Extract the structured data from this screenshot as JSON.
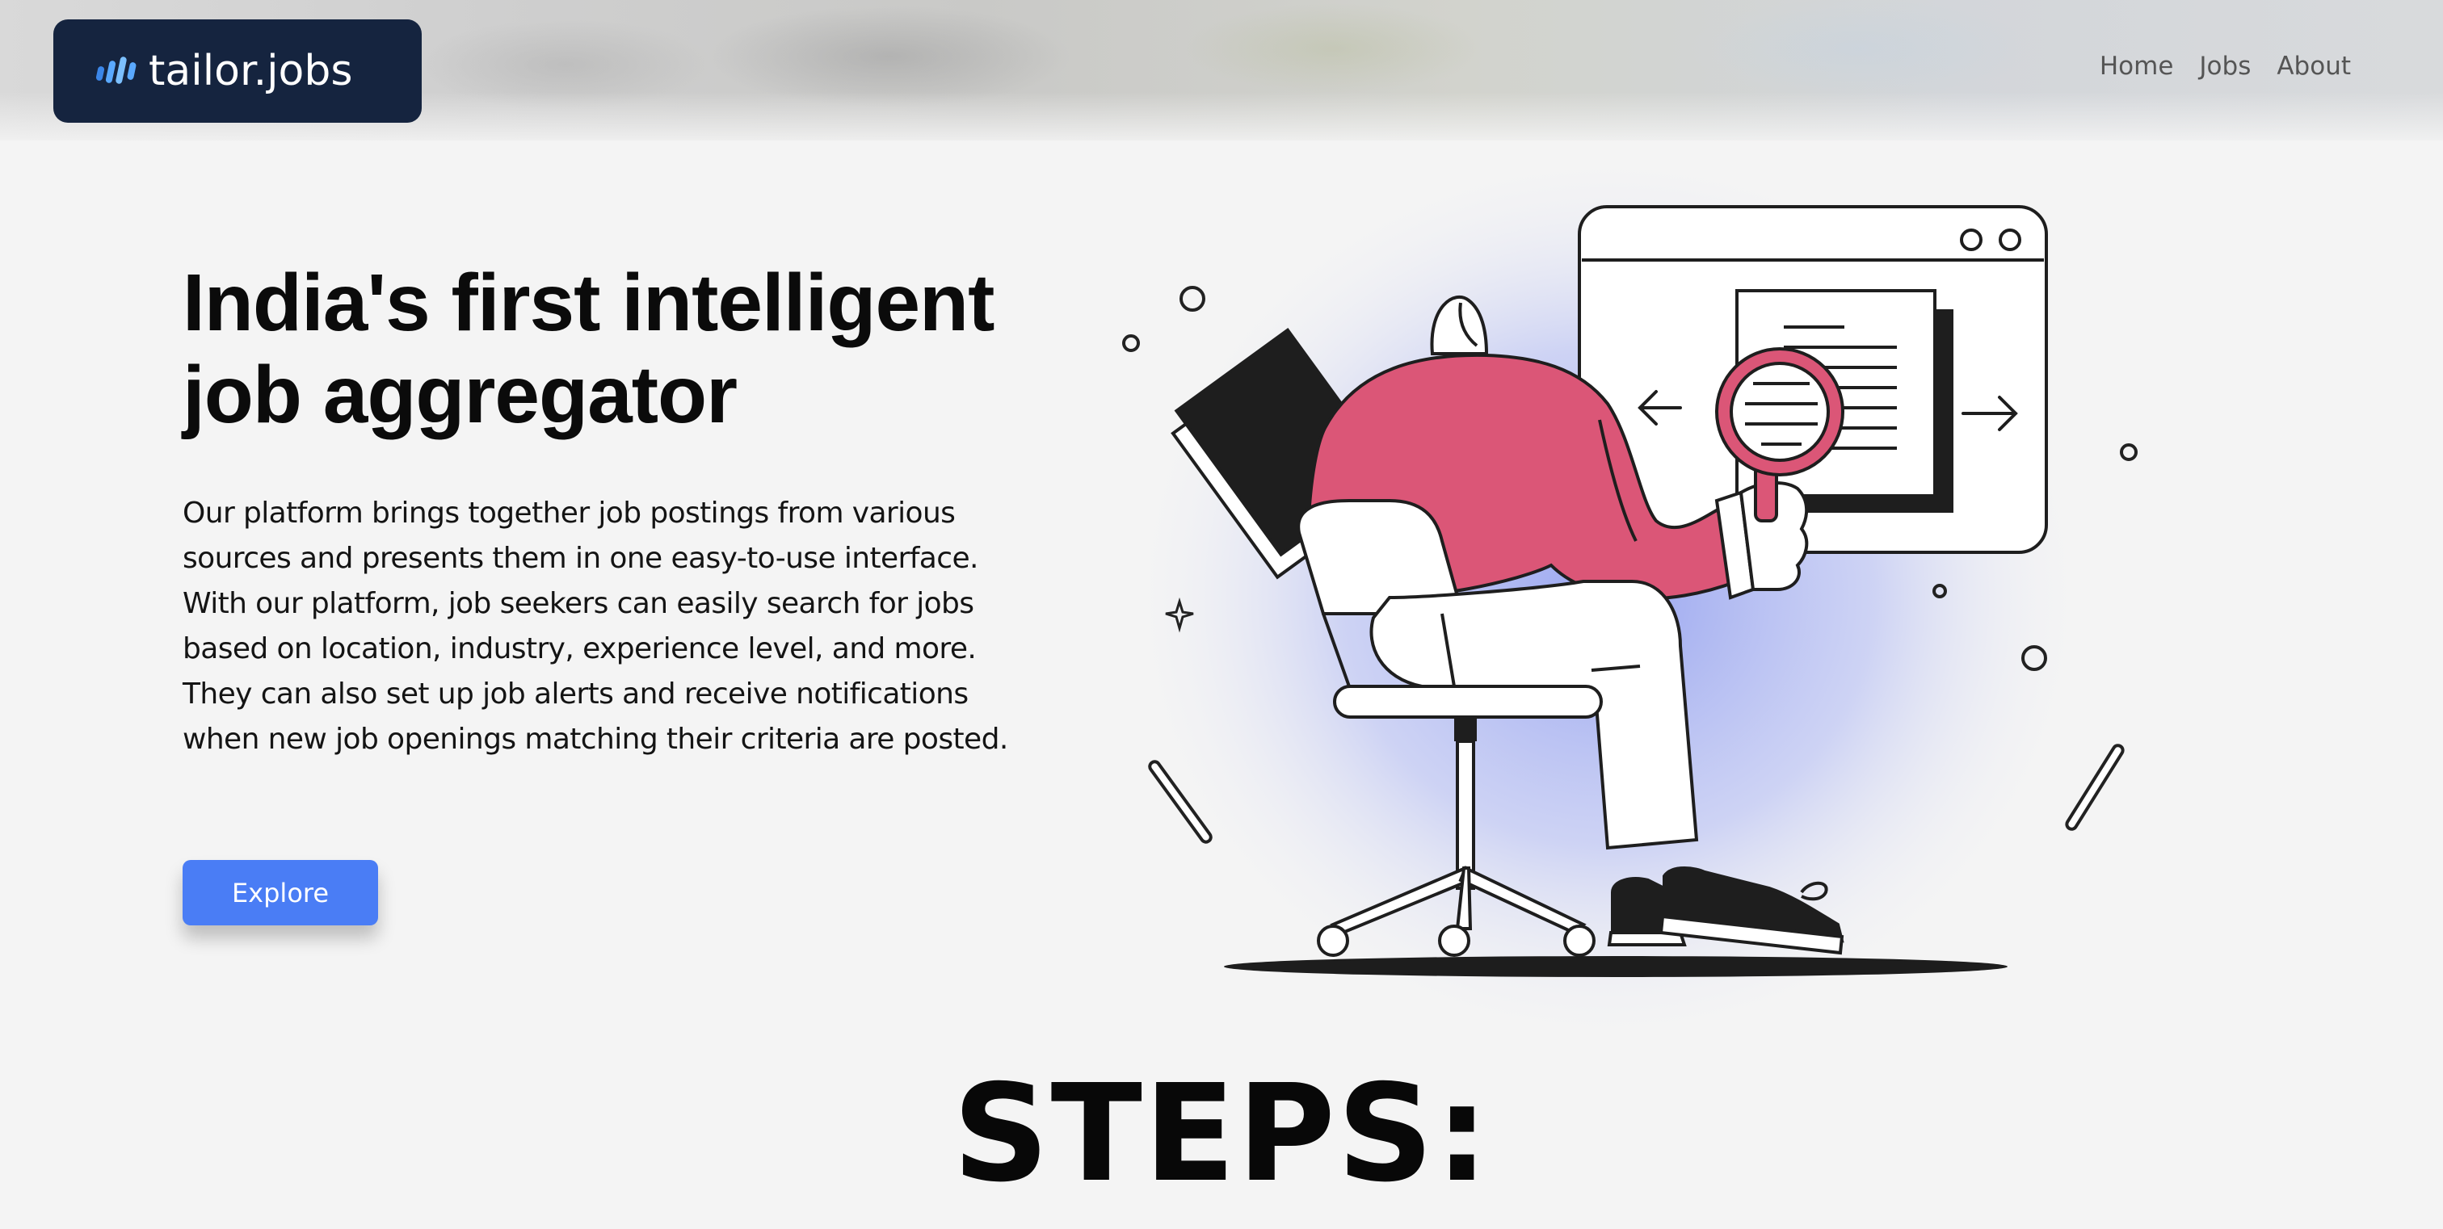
{
  "header": {
    "logo_text": "tailor.jobs",
    "logo_icon": "sound-bars-icon",
    "nav": [
      {
        "label": "Home"
      },
      {
        "label": "Jobs"
      },
      {
        "label": "About"
      }
    ]
  },
  "hero": {
    "title": "India's first intelligent job aggregator",
    "description": "Our platform brings together job postings from various sources and presents them in one easy-to-use interface. With our platform, job seekers can easily search for jobs based on location, industry, experience level, and more. They can also set up job alerts and receive notifications when new job openings matching their criteria are posted.",
    "button_label": "Explore",
    "illustration": "person-searching-jobs-illustration"
  },
  "steps": {
    "title": "STEPS:"
  },
  "colors": {
    "logo_bg": "#15243f",
    "logo_accent": "#5aa9ff",
    "button": "#4a7df5",
    "illustration_accent": "#db5677",
    "illustration_glow": "#a9b4f2",
    "background": "#f4f4f4"
  }
}
